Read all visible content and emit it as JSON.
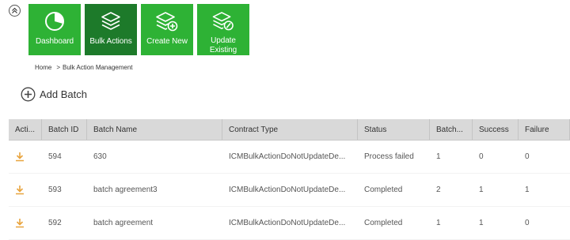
{
  "toolbar": {
    "tiles": [
      {
        "label": "Dashboard",
        "icon": "pie-chart-icon"
      },
      {
        "label": "Bulk Actions",
        "icon": "layers-icon"
      },
      {
        "label": "Create New",
        "icon": "layers-add-icon"
      },
      {
        "label": "Update Existing",
        "icon": "layers-edit-icon"
      }
    ],
    "active_tile": "Bulk Actions"
  },
  "breadcrumb": {
    "home": "Home",
    "separator": ">",
    "current": "Bulk Action Management"
  },
  "add_batch": {
    "label": "Add Batch",
    "icon": "plus-circle-icon"
  },
  "grid": {
    "headers": [
      "Acti...",
      "Batch ID",
      "Batch Name",
      "Contract Type",
      "Status",
      "Batch...",
      "Success",
      "Failure"
    ],
    "rows": [
      {
        "action_icon": "download-icon",
        "batch_id": "594",
        "batch_name": "630",
        "contract_type": "ICMBulkActionDoNotUpdateDe...",
        "status": "Process failed",
        "batch_count": "1",
        "success": "0",
        "failure": "0"
      },
      {
        "action_icon": "download-icon",
        "batch_id": "593",
        "batch_name": "batch agreement3",
        "contract_type": "ICMBulkActionDoNotUpdateDe...",
        "status": "Completed",
        "batch_count": "2",
        "success": "1",
        "failure": "1"
      },
      {
        "action_icon": "download-icon",
        "batch_id": "592",
        "batch_name": "batch agreement",
        "contract_type": "ICMBulkActionDoNotUpdateDe...",
        "status": "Completed",
        "batch_count": "1",
        "success": "1",
        "failure": "0"
      }
    ]
  },
  "colors": {
    "tile": "#2eb235",
    "tile_active": "#1d7a2a",
    "download_icon": "#e8a33d",
    "header_bg": "#d9d9d9"
  }
}
